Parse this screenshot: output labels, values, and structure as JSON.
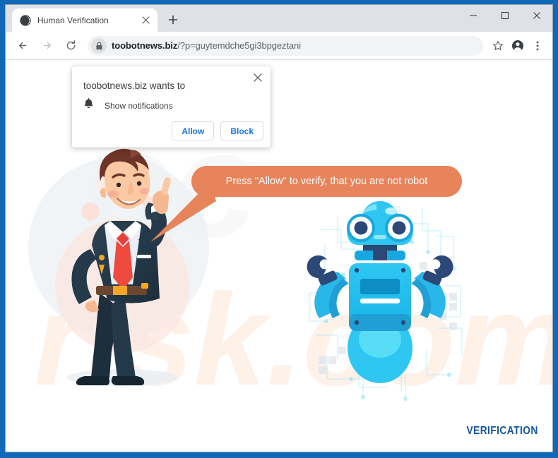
{
  "window": {
    "border_color": "#1168b8",
    "controls": [
      {
        "name": "minimize",
        "glyph": "minimize-icon"
      },
      {
        "name": "maximize",
        "glyph": "maximize-icon"
      },
      {
        "name": "close",
        "glyph": "close-icon"
      }
    ]
  },
  "tab": {
    "title": "Human Verification",
    "favicon": "globe-icon",
    "close_icon": "close-icon",
    "new_tab_icon": "plus-icon"
  },
  "toolbar": {
    "back_icon": "arrow-left-icon",
    "forward_icon": "arrow-right-icon",
    "reload_icon": "reload-icon",
    "lock_icon": "lock-icon",
    "url_domain": "toobotnews.biz",
    "url_path": "/?p=guytemdche5gi3bpgeztani",
    "bookmark_icon": "star-icon",
    "profile_icon": "account-avatar-icon",
    "menu_icon": "three-dot-menu-icon"
  },
  "dialog": {
    "title": "toobotnews.biz wants to",
    "permission_icon": "bell-icon",
    "permission_label": "Show notifications",
    "allow_label": "Allow",
    "block_label": "Block",
    "close_icon": "close-icon",
    "accent_color": "#1a73e8"
  },
  "page": {
    "speech_bubble_text": "Press \"Allow\" to verify, that you are not robot",
    "speech_bubble_color": "#e8845b",
    "businessman_illustration": "businessman-pointing-up-illustration",
    "robot_illustration": "blue-robot-illustration",
    "circuit_background": "circuit-board-pattern",
    "watermark_text": "pcrisk.com",
    "verification_label": "VERIFICATION",
    "verification_color": "#15569e"
  }
}
